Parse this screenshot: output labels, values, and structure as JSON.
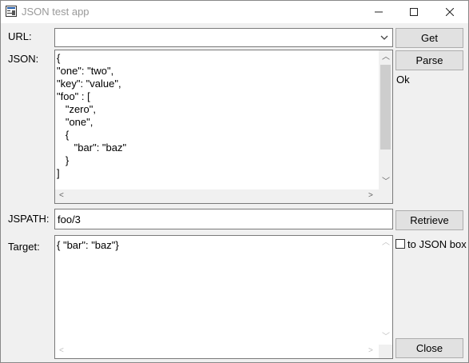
{
  "window": {
    "title": "JSON test app"
  },
  "labels": {
    "url": "URL:",
    "json": "JSON:",
    "jspath": "JSPATH:",
    "target": "Target:"
  },
  "url": {
    "value": ""
  },
  "json": {
    "lines": [
      "{",
      "\"one\": \"two\",",
      "\"key\": \"value\",",
      "\"foo\" : [",
      "   \"zero\",",
      "   \"one\",",
      "   {",
      "      \"bar\": \"baz\"",
      "   }",
      "]"
    ]
  },
  "jspath": {
    "value": "foo/3"
  },
  "target": {
    "value": "{ \"bar\": \"baz\"}"
  },
  "buttons": {
    "get": "Get",
    "parse": "Parse",
    "retrieve": "Retrieve",
    "close": "Close"
  },
  "status": "Ok",
  "to_json_box": {
    "label": "to JSON box",
    "checked": false
  }
}
